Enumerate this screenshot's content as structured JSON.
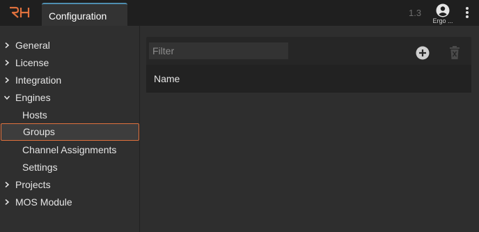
{
  "app": {
    "logo_text": "RH"
  },
  "tabs": [
    {
      "label": "Configuration"
    }
  ],
  "header": {
    "version": "1.3",
    "user_name": "Ergo ..."
  },
  "colors": {
    "accent_orange": "#e0713d",
    "tab_accent_blue": "#4f8fb0",
    "background": "#2e2e2e"
  },
  "sidebar": {
    "items": [
      {
        "label": "General",
        "expandable": true,
        "expanded": false
      },
      {
        "label": "License",
        "expandable": true,
        "expanded": false
      },
      {
        "label": "Integration",
        "expandable": true,
        "expanded": false
      },
      {
        "label": "Engines",
        "expandable": true,
        "expanded": true
      },
      {
        "label": "Hosts",
        "expandable": false
      },
      {
        "label": "Groups",
        "expandable": false,
        "selected": true
      },
      {
        "label": "Channel Assignments",
        "expandable": false
      },
      {
        "label": "Settings",
        "expandable": false
      },
      {
        "label": "Projects",
        "expandable": true,
        "expanded": false
      },
      {
        "label": "MOS Module",
        "expandable": true,
        "expanded": false
      }
    ]
  },
  "main": {
    "filter_placeholder": "Filter",
    "filter_value": "",
    "table": {
      "columns": [
        "Name"
      ],
      "rows": []
    },
    "icons": {
      "add": "add-circle-icon",
      "delete": "trash-icon"
    }
  }
}
